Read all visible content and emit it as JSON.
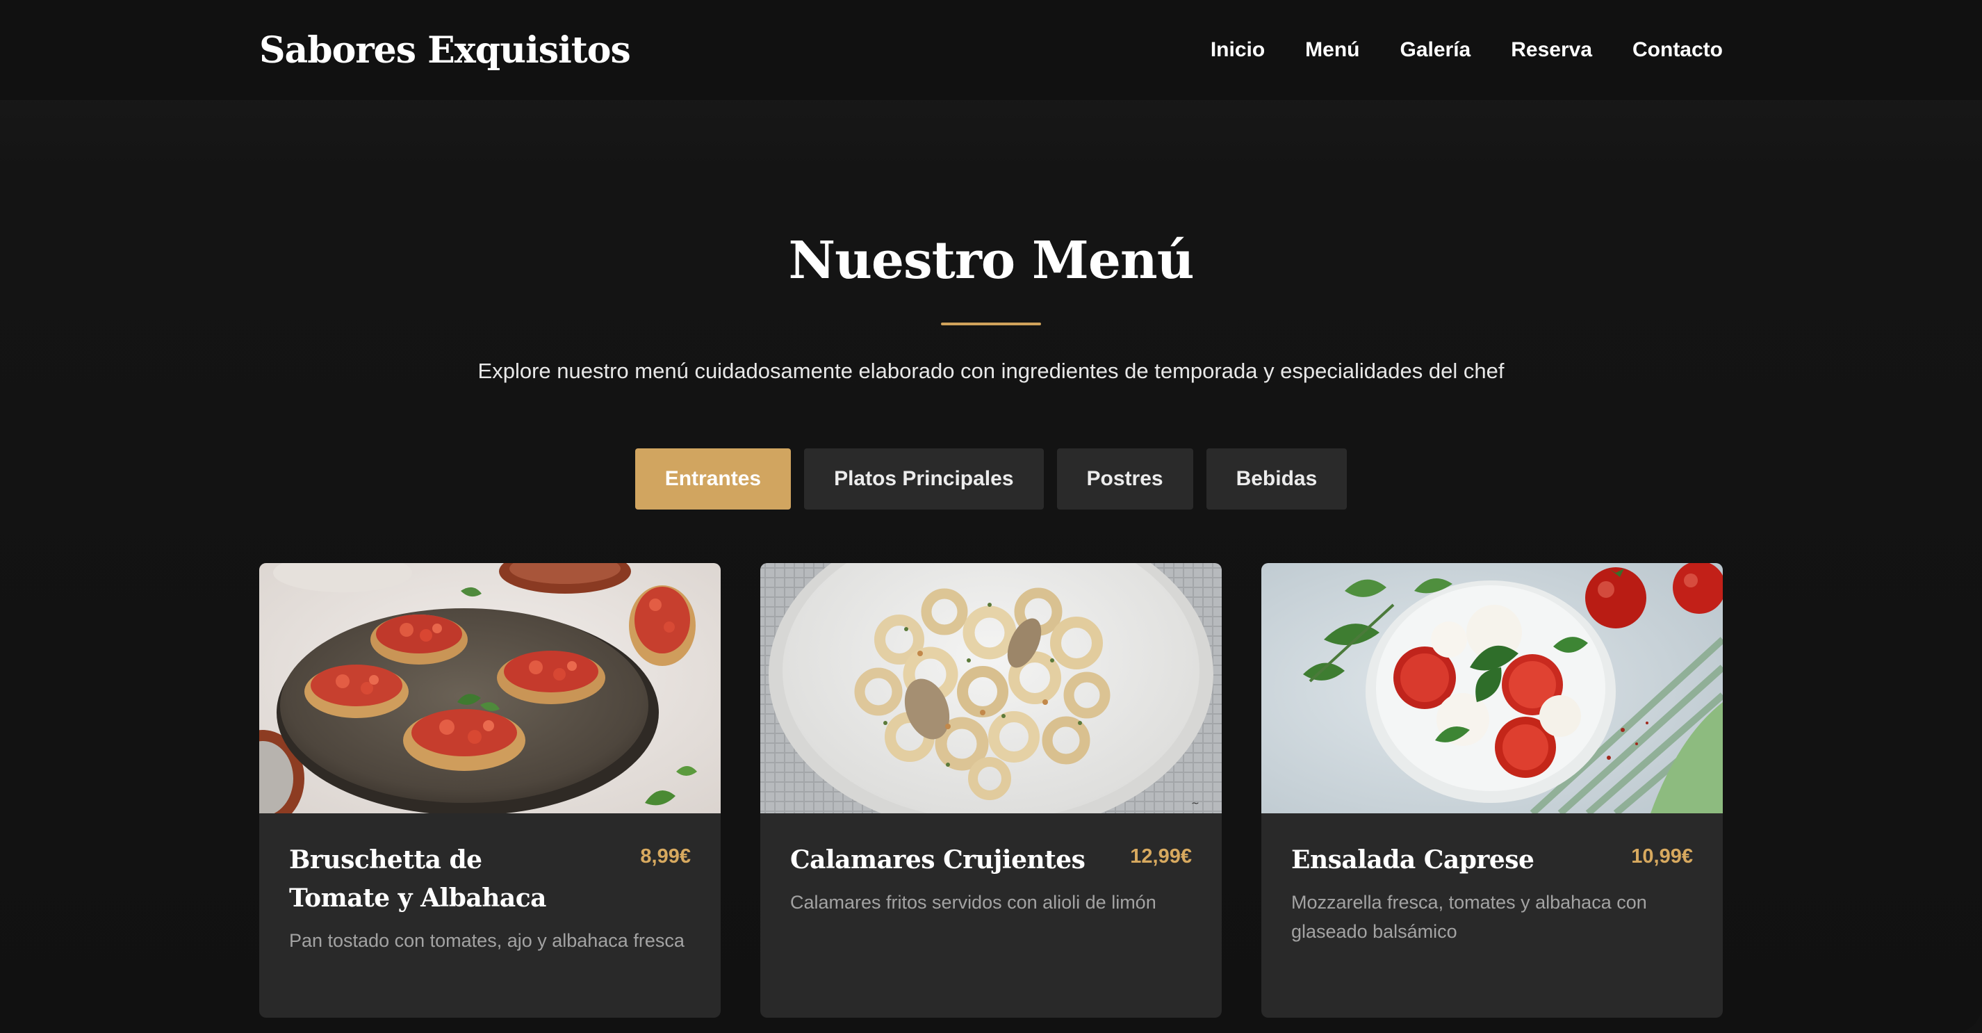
{
  "header": {
    "brand": "Sabores Exquisitos",
    "nav": [
      "Inicio",
      "Menú",
      "Galería",
      "Reserva",
      "Contacto"
    ]
  },
  "section": {
    "title": "Nuestro Menú",
    "subtitle": "Explore nuestro menú cuidadosamente elaborado con ingredientes de temporada y especialidades del chef"
  },
  "tabs": {
    "items": [
      "Entrantes",
      "Platos Principales",
      "Postres",
      "Bebidas"
    ],
    "active": "Entrantes"
  },
  "menu": {
    "items": [
      {
        "title": "Bruschetta de Tomate y Albahaca",
        "price": "8,99€",
        "description": "Pan tostado con tomates, ajo y albahaca fresca",
        "image": "bruschetta-photo"
      },
      {
        "title": "Calamares Crujientes",
        "price": "12,99€",
        "description": "Calamares fritos servidos con alioli de limón",
        "image": "calamari-photo"
      },
      {
        "title": "Ensalada Caprese",
        "price": "10,99€",
        "description": "Mozzarella fresca, tomates y albahaca con glaseado balsámico",
        "image": "caprese-photo"
      }
    ]
  },
  "colors": {
    "background": "#131313",
    "header": "#111111",
    "accent": "#d1a560",
    "card": "#292929",
    "tab": "#2a2a2a"
  }
}
